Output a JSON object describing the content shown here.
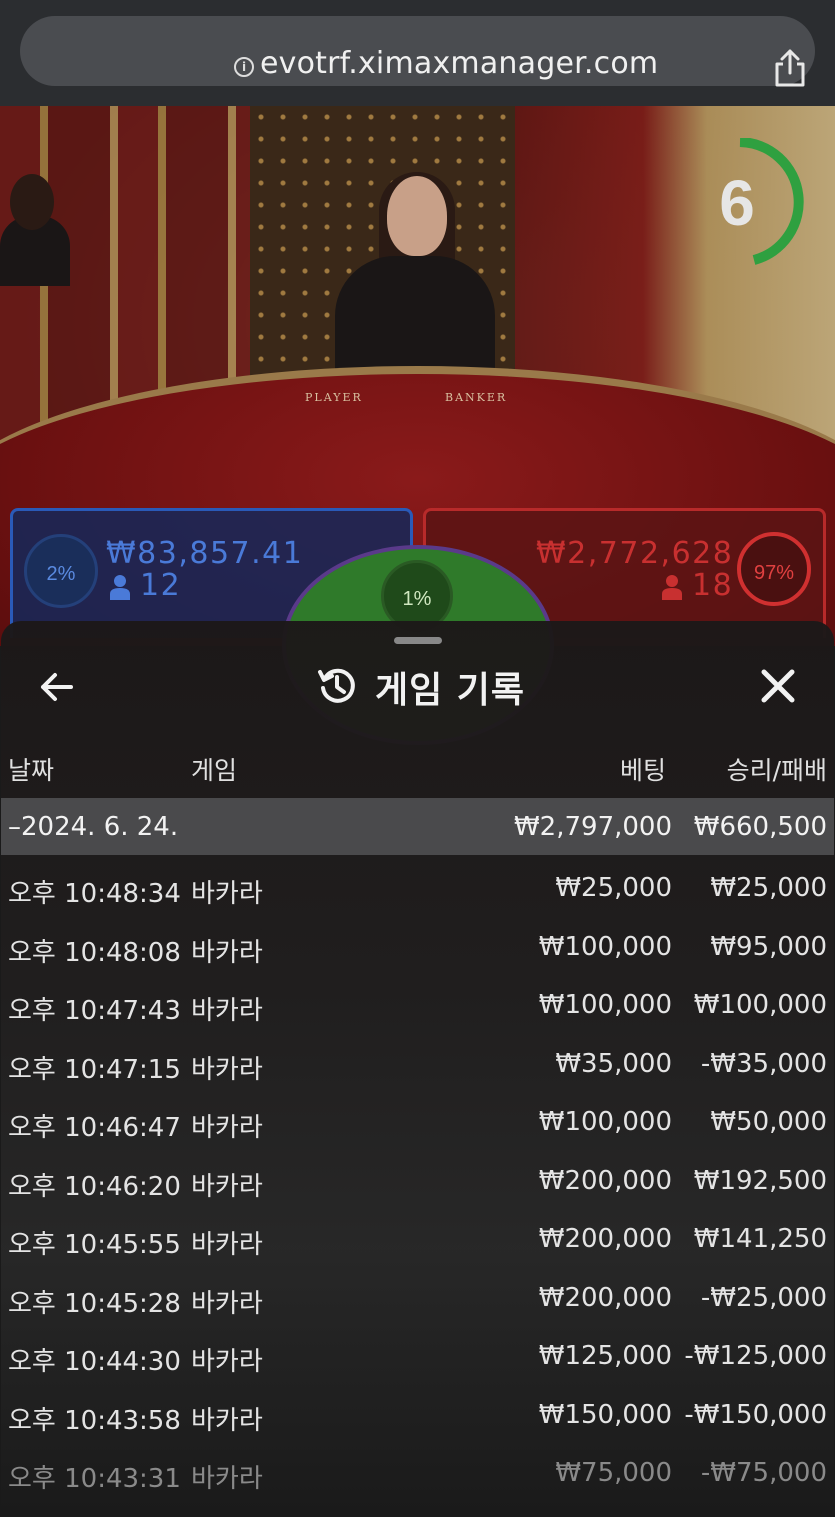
{
  "browser": {
    "url": "evotrf.ximaxmanager.com"
  },
  "stream": {
    "countdown": "6",
    "table_labels": {
      "player": "PLAYER",
      "banker": "BANKER"
    }
  },
  "bets": {
    "player": {
      "percent": "2%",
      "amount": "₩83,857.41",
      "count": "12",
      "color": "#2a5ab8"
    },
    "tie": {
      "percent": "1%",
      "color": "#2f7a2a"
    },
    "banker": {
      "percent": "97%",
      "amount": "₩2,772,628",
      "count": "18",
      "color": "#b82a2a"
    }
  },
  "history": {
    "title": "게임 기록",
    "columns": {
      "date": "날짜",
      "game": "게임",
      "bet": "베팅",
      "win_loss": "승리/패배"
    },
    "day": {
      "date": "–2024. 6. 24.",
      "bet_total": "₩2,797,000",
      "win_total": "₩660,500"
    },
    "rows": [
      {
        "time": "오후 10:48:34",
        "game": "바카라",
        "bet": "₩25,000",
        "win": "₩25,000"
      },
      {
        "time": "오후 10:48:08",
        "game": "바카라",
        "bet": "₩100,000",
        "win": "₩95,000"
      },
      {
        "time": "오후 10:47:43",
        "game": "바카라",
        "bet": "₩100,000",
        "win": "₩100,000"
      },
      {
        "time": "오후 10:47:15",
        "game": "바카라",
        "bet": "₩35,000",
        "win": "-₩35,000"
      },
      {
        "time": "오후 10:46:47",
        "game": "바카라",
        "bet": "₩100,000",
        "win": "₩50,000"
      },
      {
        "time": "오후 10:46:20",
        "game": "바카라",
        "bet": "₩200,000",
        "win": "₩192,500"
      },
      {
        "time": "오후 10:45:55",
        "game": "바카라",
        "bet": "₩200,000",
        "win": "₩141,250"
      },
      {
        "time": "오후 10:45:28",
        "game": "바카라",
        "bet": "₩200,000",
        "win": "-₩25,000"
      },
      {
        "time": "오후 10:44:30",
        "game": "바카라",
        "bet": "₩125,000",
        "win": "-₩125,000"
      },
      {
        "time": "오후 10:43:58",
        "game": "바카라",
        "bet": "₩150,000",
        "win": "-₩150,000"
      },
      {
        "time": "오후 10:43:31",
        "game": "바카라",
        "bet": "₩75,000",
        "win": "-₩75,000"
      }
    ]
  }
}
